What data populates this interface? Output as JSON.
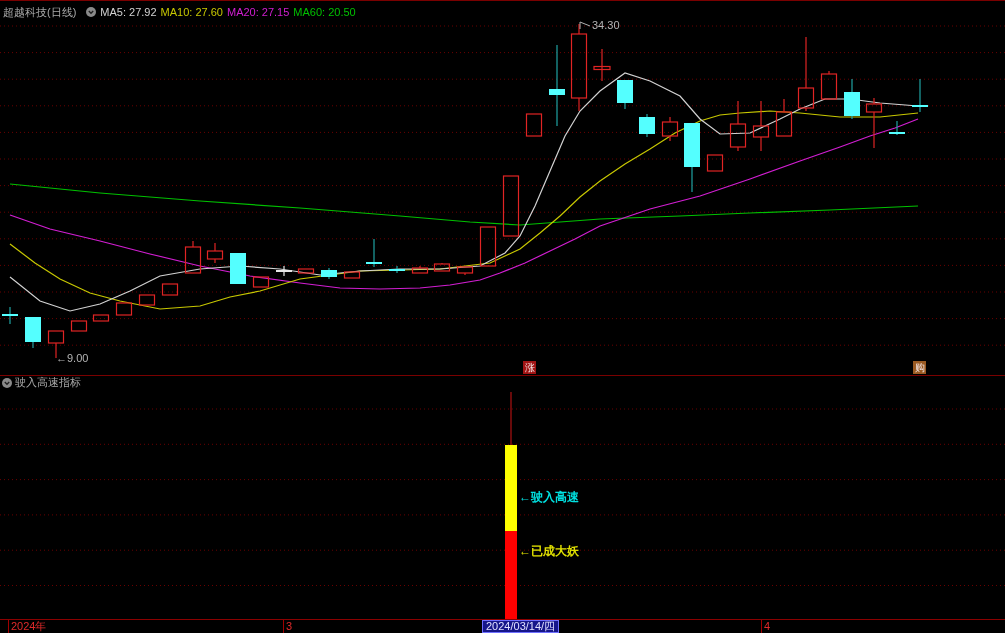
{
  "chart_header": {
    "title": "超越科技(日线)",
    "ma_legend": [
      {
        "label": "MA5: 27.92",
        "color": "#d2d2d2"
      },
      {
        "label": "MA10: 27.60",
        "color": "#c8c800"
      },
      {
        "label": "MA20: 27.15",
        "color": "#d21ed2"
      },
      {
        "label": "MA60: 20.50",
        "color": "#00c000"
      }
    ]
  },
  "price_chart": {
    "high_label": "34.30",
    "low_label": "←9.00",
    "signals": [
      {
        "text": "涨",
        "color": "#a01414"
      },
      {
        "text": "购",
        "color": "#9a5a22"
      }
    ]
  },
  "indicator_panel": {
    "title": "驶入高速指标",
    "bar_labels": [
      {
        "text": "←驶入高速",
        "color": "#00e0e0"
      },
      {
        "text": "←已成大妖",
        "color": "#e0e000"
      }
    ]
  },
  "time_axis": [
    {
      "label": "2024年",
      "selected": false
    },
    {
      "label": "3",
      "selected": false
    },
    {
      "label": "2024/03/14/四",
      "selected": true
    },
    {
      "label": "4",
      "selected": false
    }
  ]
}
